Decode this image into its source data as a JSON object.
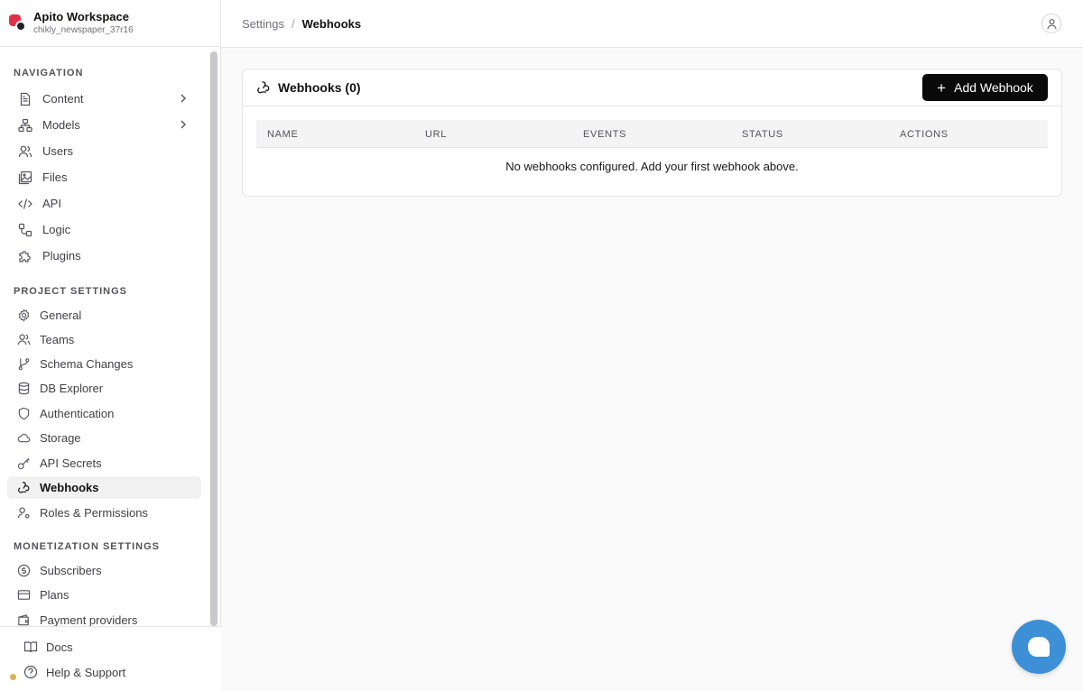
{
  "workspace": {
    "name": "Apito Workspace",
    "project": "chikly_newspaper_37r16"
  },
  "navigation": {
    "title": "NAVIGATION",
    "items": [
      {
        "label": "Content",
        "icon": "file-text-icon",
        "has_submenu": true
      },
      {
        "label": "Models",
        "icon": "sitemap-icon",
        "has_submenu": true
      },
      {
        "label": "Users",
        "icon": "users-icon"
      },
      {
        "label": "Files",
        "icon": "image-icon"
      },
      {
        "label": "API",
        "icon": "code-icon"
      },
      {
        "label": "Logic",
        "icon": "workflow-icon"
      },
      {
        "label": "Plugins",
        "icon": "puzzle-icon"
      }
    ]
  },
  "project_settings": {
    "title": "PROJECT SETTINGS",
    "items": [
      {
        "label": "General",
        "icon": "gear-icon"
      },
      {
        "label": "Teams",
        "icon": "users-icon"
      },
      {
        "label": "Schema Changes",
        "icon": "git-branch-icon"
      },
      {
        "label": "DB Explorer",
        "icon": "database-icon"
      },
      {
        "label": "Authentication",
        "icon": "shield-icon"
      },
      {
        "label": "Storage",
        "icon": "cloud-icon"
      },
      {
        "label": "API Secrets",
        "icon": "key-icon"
      },
      {
        "label": "Webhooks",
        "icon": "webhook-icon",
        "active": true
      },
      {
        "label": "Roles & Permissions",
        "icon": "user-cog-icon"
      }
    ]
  },
  "monetization_settings": {
    "title": "MONETIZATION SETTINGS",
    "items": [
      {
        "label": "Subscribers",
        "icon": "dollar-circle-icon"
      },
      {
        "label": "Plans",
        "icon": "credit-card-icon"
      },
      {
        "label": "Payment providers",
        "icon": "wallet-icon"
      }
    ]
  },
  "footer": {
    "docs": "Docs",
    "help": "Help & Support"
  },
  "breadcrumb": {
    "parent": "Settings",
    "separator": "/",
    "current": "Webhooks"
  },
  "webhooks_card": {
    "title": "Webhooks (0)",
    "add_button": "Add Webhook",
    "columns": [
      "NAME",
      "URL",
      "EVENTS",
      "STATUS",
      "ACTIONS"
    ],
    "empty_message": "No webhooks configured. Add your first webhook above."
  },
  "colors": {
    "accent": "#0a0a0a",
    "chat_fab": "#3d8fd6",
    "logo_red": "#e0314b"
  }
}
